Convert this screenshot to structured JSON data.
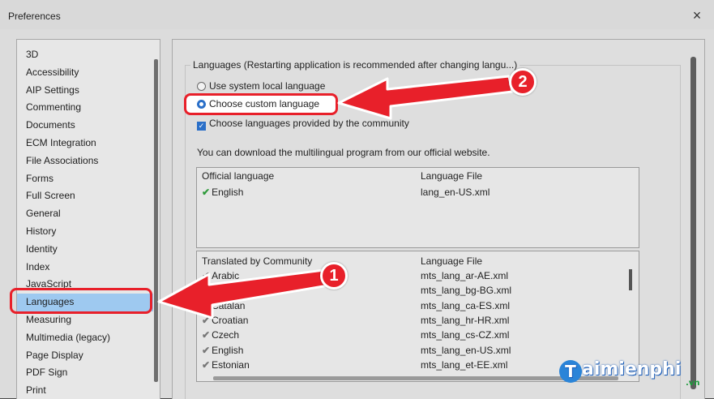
{
  "window": {
    "title": "Preferences",
    "close": "×"
  },
  "categories": [
    {
      "label": "3D"
    },
    {
      "label": "Accessibility"
    },
    {
      "label": "AIP Settings"
    },
    {
      "label": "Commenting"
    },
    {
      "label": "Documents"
    },
    {
      "label": "ECM Integration"
    },
    {
      "label": "File Associations"
    },
    {
      "label": "Forms"
    },
    {
      "label": "Full Screen"
    },
    {
      "label": "General"
    },
    {
      "label": "History"
    },
    {
      "label": "Identity"
    },
    {
      "label": "Index"
    },
    {
      "label": "JavaScript"
    },
    {
      "label": "Languages"
    },
    {
      "label": "Measuring"
    },
    {
      "label": "Multimedia (legacy)"
    },
    {
      "label": "Page Display"
    },
    {
      "label": "PDF Sign"
    },
    {
      "label": "Print"
    }
  ],
  "selected_category": "Languages",
  "languages": {
    "group_title": "Languages (Restarting application is recommended after changing langu...)",
    "option_system": "Use system local language",
    "option_custom": "Choose custom language",
    "option_community": "Choose languages provided by the community",
    "download_note": "You can download the multilingual program from our official website.",
    "official": {
      "col1": "Official language",
      "col2": "Language File",
      "rows": [
        {
          "name": "English",
          "file": "lang_en-US.xml"
        }
      ]
    },
    "community": {
      "col1": "Translated by Community",
      "col2": "Language File",
      "rows": [
        {
          "name": "Arabic",
          "file": "mts_lang_ar-AE.xml"
        },
        {
          "name": "",
          "file": "mts_lang_bg-BG.xml"
        },
        {
          "name": "Catalan",
          "file": "mts_lang_ca-ES.xml"
        },
        {
          "name": "Croatian",
          "file": "mts_lang_hr-HR.xml"
        },
        {
          "name": "Czech",
          "file": "mts_lang_cs-CZ.xml"
        },
        {
          "name": "English",
          "file": "mts_lang_en-US.xml"
        },
        {
          "name": "Estonian",
          "file": "mts_lang_et-EE.xml"
        }
      ]
    }
  },
  "annotations": {
    "badge1": "1",
    "badge2": "2"
  },
  "watermark": {
    "logo": "T",
    "text": "aimienphi",
    "suffix": ".vn"
  },
  "colors": {
    "annotation": "#e8202a",
    "selection": "#9ec9f0",
    "accent": "#2a6fc8"
  }
}
